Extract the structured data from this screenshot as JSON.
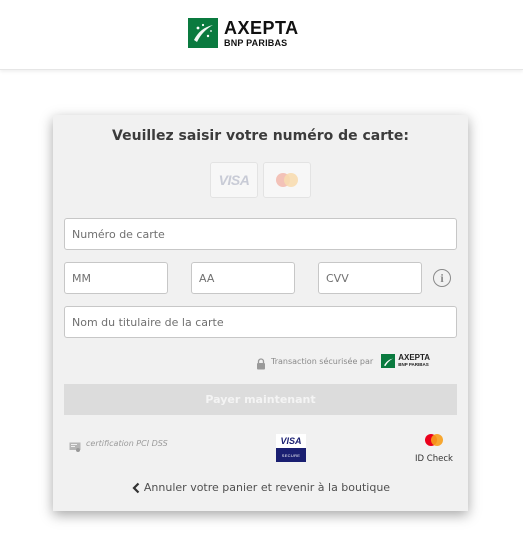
{
  "header": {
    "logo_title": "AXEPTA",
    "logo_subtitle": "BNP PARIBAS"
  },
  "form": {
    "title": "Veuillez saisir votre numéro de carte:",
    "brands": [
      {
        "name": "VISA",
        "icon": "visa-icon"
      },
      {
        "name": "Mastercard",
        "icon": "mastercard-icon"
      }
    ],
    "card_number": {
      "placeholder": "Numéro de carte",
      "value": ""
    },
    "month": {
      "placeholder": "MM",
      "value": ""
    },
    "year": {
      "placeholder": "AA",
      "value": ""
    },
    "cvv": {
      "placeholder": "CVV",
      "value": ""
    },
    "cardholder": {
      "placeholder": "Nom du titulaire de la carte",
      "value": ""
    },
    "secure_text": "Transaction sécurisée par",
    "secure_brand_title": "AXEPTA",
    "secure_brand_subtitle": "BNP PARIBAS",
    "pay_label": "Payer maintenant"
  },
  "footer": {
    "pci_text": "certification PCI DSS",
    "visa_secure_title": "VISA",
    "visa_secure_subtitle": "SECURE",
    "idcheck_label": "ID Check",
    "cancel_label": "Annuler votre panier et revenir à la boutique"
  },
  "colors": {
    "brand_green": "#0a7a3f",
    "visa_blue": "#1a1f71",
    "mc_red": "#eb001b",
    "mc_orange": "#f79e1b"
  }
}
